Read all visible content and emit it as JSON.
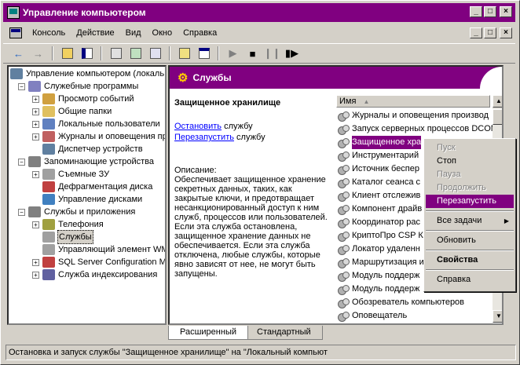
{
  "window": {
    "title": "Управление компьютером",
    "min": "_",
    "max": "□",
    "close": "×"
  },
  "menu": {
    "items": [
      "Консоль",
      "Действие",
      "Вид",
      "Окно",
      "Справка"
    ]
  },
  "tree": {
    "root": "Управление компьютером (локаль",
    "items": [
      {
        "label": "Служебные программы",
        "level": 1,
        "expander": "−",
        "color": "#8080c0"
      },
      {
        "label": "Просмотр событий",
        "level": 2,
        "expander": "+",
        "color": "#d0a040"
      },
      {
        "label": "Общие папки",
        "level": 2,
        "expander": "+",
        "color": "#e0c060"
      },
      {
        "label": "Локальные пользователи",
        "level": 2,
        "expander": "+",
        "color": "#6080c0"
      },
      {
        "label": "Журналы и оповещения пр",
        "level": 2,
        "expander": "+",
        "color": "#c06060"
      },
      {
        "label": "Диспетчер устройств",
        "level": 2,
        "expander": "",
        "color": "#6080a0"
      },
      {
        "label": "Запоминающие устройства",
        "level": 1,
        "expander": "−",
        "color": "#808080"
      },
      {
        "label": "Съемные ЗУ",
        "level": 2,
        "expander": "+",
        "color": "#a0a0a0"
      },
      {
        "label": "Дефрагментация диска",
        "level": 2,
        "expander": "",
        "color": "#c04040"
      },
      {
        "label": "Управление дисками",
        "level": 2,
        "expander": "",
        "color": "#4080c0"
      },
      {
        "label": "Службы и приложения",
        "level": 1,
        "expander": "−",
        "color": "#808080"
      },
      {
        "label": "Телефония",
        "level": 2,
        "expander": "+",
        "color": "#a0a040"
      },
      {
        "label": "Службы",
        "level": 2,
        "expander": "",
        "color": "#a0a0a0",
        "selected": true
      },
      {
        "label": "Управляющий элемент WM",
        "level": 2,
        "expander": "",
        "color": "#a0a0a0"
      },
      {
        "label": "SQL Server Configuration M",
        "level": 2,
        "expander": "+",
        "color": "#c04040"
      },
      {
        "label": "Служба индексирования",
        "level": 2,
        "expander": "+",
        "color": "#6060a0"
      }
    ]
  },
  "panel": {
    "header": "Службы",
    "service_name": "Защищенное хранилище",
    "stop_link": "Остановить",
    "stop_suffix": " службу",
    "restart_link": "Перезапустить",
    "restart_suffix": " службу",
    "desc_label": "Описание:",
    "desc_text": "Обеспечивает защищенное хранение секретных данных, таких, как закрытые ключи, и предотвращает несанкционированный доступ к ним служб, процессов или пользователей. Если эта служба остановлена, защищенное хранение данных не обеспечивается. Если эта служба отключена, любые службы, которые явно зависят от нее, не могут быть запущены."
  },
  "list": {
    "column": "Имя",
    "sort_arrow": "▲",
    "rows": [
      "Журналы и оповещения производ",
      "Запуск серверных процессов DCOM",
      "Защищенное хра",
      "Инструментарий",
      "Источник беспер",
      "Каталог сеанса с",
      "Клиент отслежив",
      "Компонент драйв",
      "Координатор рас",
      "КриптоПро CSP К",
      "Локатор удаленн",
      "Маршрутизация и",
      "Модуль поддерж",
      "Модуль поддерж",
      "Обозреватель компьютеров",
      "Оповещатель"
    ],
    "selected_index": 2
  },
  "context_menu": {
    "items": [
      {
        "label": "Пуск",
        "disabled": true
      },
      {
        "label": "Стоп"
      },
      {
        "label": "Пауза",
        "disabled": true
      },
      {
        "label": "Продолжить",
        "disabled": true
      },
      {
        "label": "Перезапустить",
        "highlight": true
      },
      {
        "sep": true
      },
      {
        "label": "Все задачи",
        "submenu": "▶"
      },
      {
        "sep": true
      },
      {
        "label": "Обновить"
      },
      {
        "sep": true
      },
      {
        "label": "Свойства",
        "bold": true
      },
      {
        "sep": true
      },
      {
        "label": "Справка"
      }
    ]
  },
  "tabs": [
    "Расширенный",
    "Стандартный"
  ],
  "status": "Остановка и запуск службы \"Защищенное хранилище\" на \"Локальный компьют",
  "colors": {
    "titlebar": "#800080",
    "selection": "#800080",
    "link": "#0000ff"
  }
}
